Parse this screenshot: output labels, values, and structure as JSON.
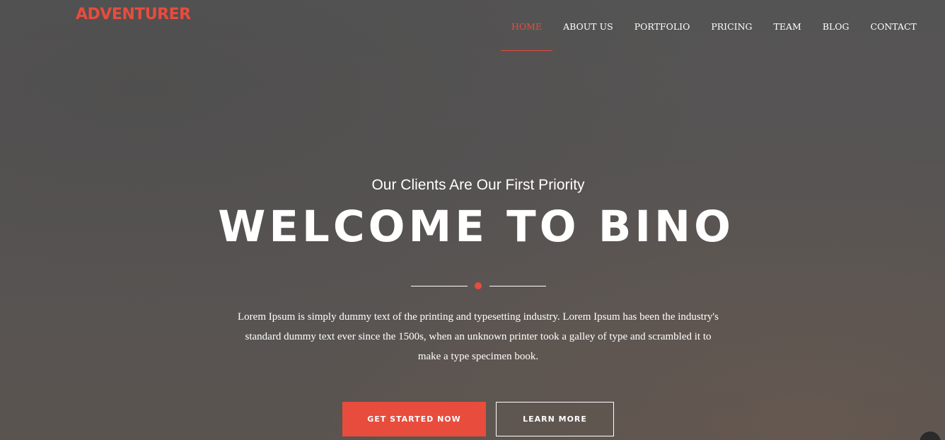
{
  "header": {
    "logo": "ADVENTURER",
    "nav": [
      {
        "label": "HOME",
        "active": true
      },
      {
        "label": "ABOUT US",
        "active": false
      },
      {
        "label": "PORTFOLIO",
        "active": false
      },
      {
        "label": "PRICING",
        "active": false
      },
      {
        "label": "TEAM",
        "active": false
      },
      {
        "label": "BLOG",
        "active": false
      },
      {
        "label": "CONTACT",
        "active": false
      }
    ]
  },
  "hero": {
    "subtitle": "Our Clients Are Our First Priority",
    "title": "WELCOME TO BINO",
    "description": "Lorem Ipsum is simply dummy text of the printing and typesetting industry. Lorem Ipsum has been the industry's standard dummy text ever since the 1500s, when an unknown printer took a galley of type and scrambled it to make a type specimen book.",
    "primary_button": "GET STARTED NOW",
    "secondary_button": "LEARN MORE"
  },
  "colors": {
    "accent": "#e84c3d",
    "overlay": "#575453",
    "text": "#ffffff"
  }
}
